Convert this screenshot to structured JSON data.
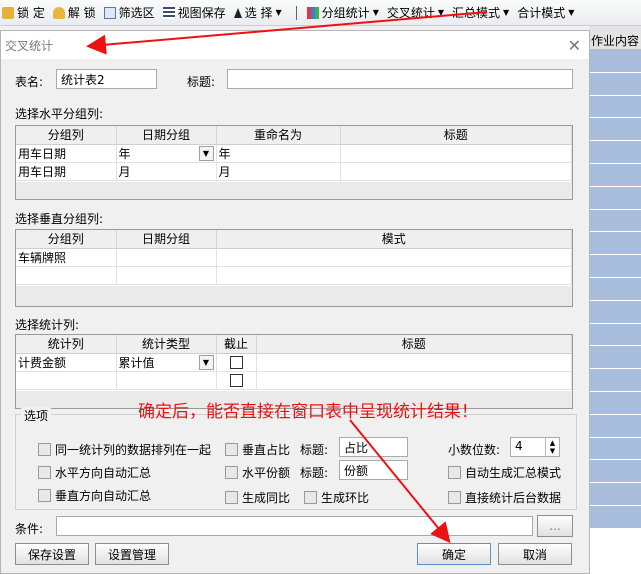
{
  "toolbar": {
    "lock": "锁 定",
    "unlock": "解 锁",
    "filter": "筛选区",
    "save_view": "视图保存",
    "select": "选 择",
    "group_stats": "分组统计",
    "cross_stats": "交叉统计",
    "summary_mode": "汇总模式",
    "total_mode": "合计模式"
  },
  "right_panel": {
    "header": "作业内容"
  },
  "dialog": {
    "title": "交叉统计",
    "table_name_label": "表名:",
    "table_name_value": "统计表2",
    "caption_label": "标题:",
    "caption_value": "",
    "horizontal_section": "选择水平分组列:",
    "horizontal_columns": [
      "分组列",
      "日期分组",
      "重命名为",
      "标题"
    ],
    "horizontal_rows": [
      [
        "用车日期",
        "年",
        "年",
        ""
      ],
      [
        "用车日期",
        "月",
        "月",
        ""
      ]
    ],
    "vertical_section": "选择垂直分组列:",
    "vertical_columns": [
      "分组列",
      "日期分组",
      "模式"
    ],
    "vertical_rows": [
      [
        "车辆牌照",
        "",
        ""
      ]
    ],
    "stat_section": "选择统计列:",
    "stat_columns": [
      "统计列",
      "统计类型",
      "截止",
      "标题"
    ],
    "stat_rows": [
      [
        "计费金额",
        "累计值",
        "",
        ""
      ]
    ],
    "options_title": "选项",
    "options": {
      "same_stat_adjacent": "同一统计列的数据排列在一起",
      "h_auto_sum": "水平方向自动汇总",
      "v_auto_sum": "垂直方向自动汇总",
      "v_ratio": "垂直占比",
      "h_share": "水平份额",
      "yoy": "生成同比",
      "mom": "生成环比",
      "title_label_1": "标题:",
      "title_value_1": "占比",
      "title_label_2": "标题:",
      "title_value_2": "份额",
      "decimals_label": "小数位数:",
      "decimals_value": "4",
      "auto_summary_mode": "自动生成汇总模式",
      "backend_stats": "直接统计后台数据"
    },
    "condition_label": "条件:",
    "condition_value": "",
    "ellipsis": "...",
    "save_settings": "保存设置",
    "manage_settings": "设置管理",
    "ok": "确定",
    "cancel": "取消"
  },
  "annotation": "确定后，能否直接在窗口表中呈现统计结果！",
  "colors": {
    "annotation": "#ee1111",
    "selection": "#a8bddb"
  }
}
